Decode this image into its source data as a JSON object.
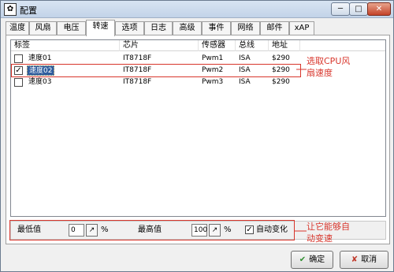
{
  "window": {
    "title": "配置",
    "app_icon": "gear-icon",
    "buttons": {
      "minimize": "─",
      "maximize": "□",
      "close": "✕"
    }
  },
  "tabs": [
    {
      "label": "温度"
    },
    {
      "label": "风扇"
    },
    {
      "label": "电压"
    },
    {
      "label": "转速",
      "active": true
    },
    {
      "label": "选项"
    },
    {
      "label": "日志"
    },
    {
      "label": "高级"
    },
    {
      "label": "事件"
    },
    {
      "label": "网络"
    },
    {
      "label": "邮件"
    },
    {
      "label": "xAP"
    }
  ],
  "list": {
    "columns": [
      "标签",
      "芯片",
      "传感器",
      "总线",
      "地址"
    ],
    "rows": [
      {
        "checked": false,
        "label": "速度01",
        "chip": "IT8718F",
        "sensor": "Pwm1",
        "bus": "ISA",
        "address": "$290",
        "selected": false
      },
      {
        "checked": true,
        "label": "速度02",
        "chip": "IT8718F",
        "sensor": "Pwm2",
        "bus": "ISA",
        "address": "$290",
        "selected": true
      },
      {
        "checked": false,
        "label": "速度03",
        "chip": "IT8718F",
        "sensor": "Pwm3",
        "bus": "ISA",
        "address": "$290",
        "selected": false
      }
    ]
  },
  "annotations": {
    "select_cpu_fan_line1": "选取CPU风",
    "select_cpu_fan_line2": "扇速度",
    "auto_change_line1": "让它能够自",
    "auto_change_line2": "动变速"
  },
  "controls": {
    "min_label": "最低值",
    "min_value": "0",
    "percent": "%",
    "max_label": "最高值",
    "max_value": "100",
    "auto_change_label": "自动变化",
    "auto_change_checked": true
  },
  "buttons": {
    "ok": "确定",
    "cancel": "取消",
    "ok_glyph": "✔",
    "cancel_glyph": "✘"
  },
  "colors": {
    "annotation": "#d8362c",
    "selection": "#2f5d9e"
  }
}
